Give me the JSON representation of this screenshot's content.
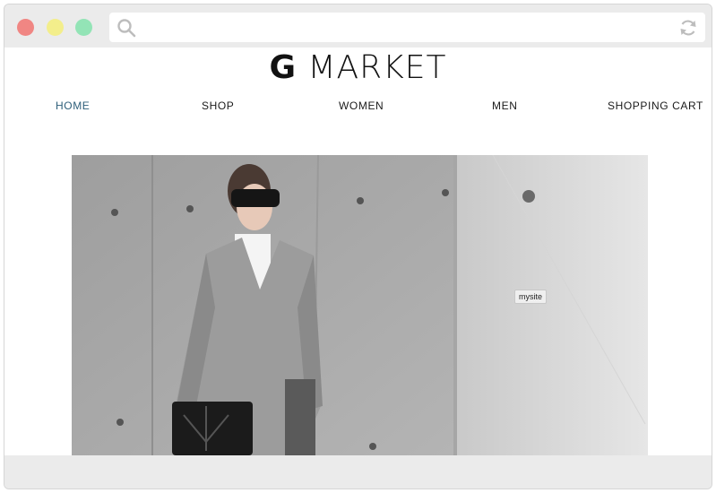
{
  "window": {
    "controls": [
      "close",
      "minimize",
      "maximize"
    ],
    "colors": {
      "close": "#f08683",
      "minimize": "#f3ee8b",
      "maximize": "#93e4b6"
    }
  },
  "addressbar": {
    "value": "",
    "icons": [
      "search-icon",
      "reload-icon"
    ]
  },
  "site": {
    "logo_bold": "G",
    "logo_rest": " MARKET",
    "nav": [
      {
        "label": "HOME",
        "active": true
      },
      {
        "label": "SHOP",
        "active": false
      },
      {
        "label": "WOMEN",
        "active": false
      },
      {
        "label": "MEN",
        "active": false
      },
      {
        "label": "SHOPPING CART",
        "active": false
      }
    ],
    "hero": {
      "tooltip": "mysite"
    },
    "accent_color": "#2e5f7a"
  }
}
